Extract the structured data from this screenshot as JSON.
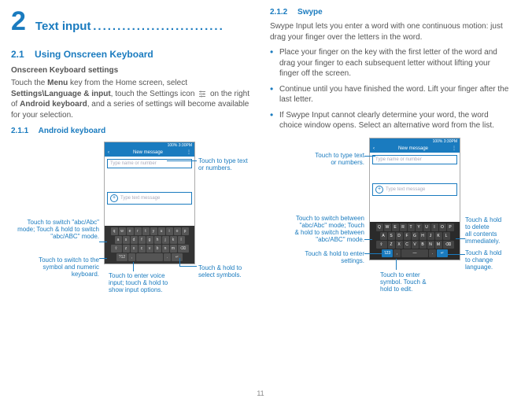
{
  "page_number": "11",
  "chapter": {
    "num": "2",
    "title": "Text input",
    "dots": "..........................."
  },
  "left": {
    "h2_num": "2.1",
    "h2_title": "Using Onscreen Keyboard",
    "settings_head": "Onscreen Keyboard settings",
    "settings_pre": "Touch the ",
    "menu": "Menu",
    "settings_mid1": " key from the Home screen, select ",
    "settings_bold1": "Settings\\Language & input",
    "settings_mid2": ", touch the Settings icon ",
    "settings_mid3": " on the right of ",
    "settings_bold2": "Android keyboard",
    "settings_end": ", and a series of settings will become available for your selection.",
    "h3_num": "2.1.1",
    "h3_title": "Android keyboard",
    "callouts": {
      "type_text": "Touch to type text\nor numbers.",
      "switch_abc": "Touch to switch \"abc/Abc\"\nmode; Touch & hold to switch\n\"abc/ABC\" mode.",
      "symbol_kbd": "Touch to switch to the\nsymbol and numeric\nkeyboard.",
      "voice": "Touch to enter voice\ninput; touch & hold to\nshow input options.",
      "symbols": "Touch & hold to\nselect symbols."
    }
  },
  "right": {
    "h3_num": "2.1.2",
    "h3_title": "Swype",
    "intro": "Swype Input lets you enter a word with one continuous motion: just drag your finger over the letters in the word.",
    "b1": "Place your finger on the key with the first letter of the word and drag your finger to each subsequent letter without lifting your finger off the screen.",
    "b2": "Continue until you have finished the word. Lift your finger after the last letter.",
    "b3": "If Swype Input cannot clearly determine your word, the word choice window opens. Select an alternative word from the list.",
    "callouts": {
      "type_text": "Touch to type text\nor numbers.",
      "switch_abc": "Touch to switch  between\n\"abc/Abc\" mode; Touch\n& hold to switch between\n\"abc/ABC\" mode.",
      "settings": "Touch & hold to enter\nsettings.",
      "symbol": "Touch to enter\nsymbol. Touch &\nhold to edit.",
      "delete": "Touch & hold\nto delete\nall contents\nimmediately.",
      "language": "Touch & hold\nto change\nlanguage."
    }
  },
  "phone": {
    "status": "100%  3:30PM",
    "title": "New message",
    "field1": "Type name or number",
    "field2": "Type text message",
    "row1_l": [
      "q",
      "w",
      "e",
      "r",
      "t",
      "y",
      "u",
      "i",
      "o",
      "p"
    ],
    "row2_l": [
      "a",
      "s",
      "d",
      "f",
      "g",
      "h",
      "j",
      "k",
      "l"
    ],
    "row3_l": [
      "z",
      "x",
      "c",
      "v",
      "b",
      "n",
      "m"
    ],
    "row1_r": [
      "Q",
      "W",
      "E",
      "R",
      "T",
      "Y",
      "U",
      "I",
      "O",
      "P"
    ],
    "row2_r": [
      "A",
      "S",
      "D",
      "F",
      "G",
      "H",
      "J",
      "K",
      "L"
    ],
    "row3_r": [
      "Z",
      "X",
      "C",
      "V",
      "B",
      "N",
      "M"
    ]
  }
}
